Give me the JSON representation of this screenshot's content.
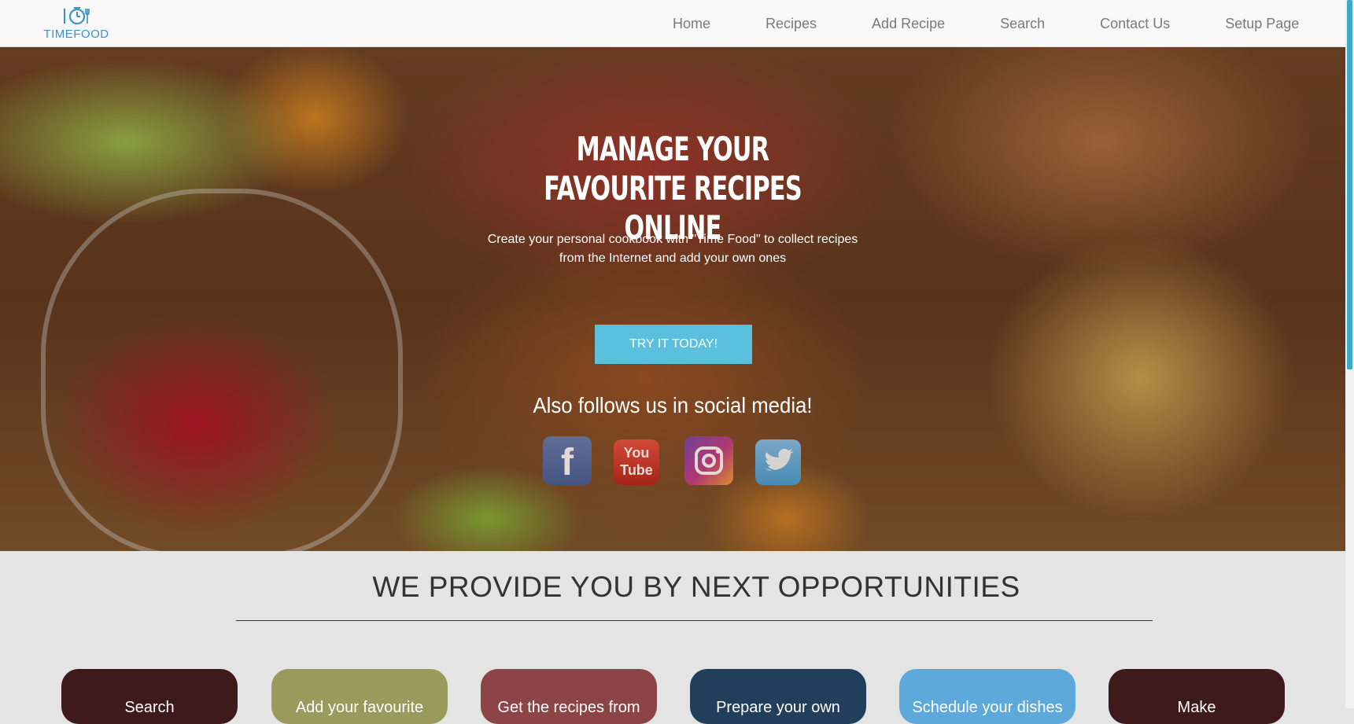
{
  "brand": {
    "name": "TIMEFOOD",
    "accent": "#3d92c5"
  },
  "nav": {
    "items": [
      {
        "label": "Home"
      },
      {
        "label": "Recipes"
      },
      {
        "label": "Add Recipe"
      },
      {
        "label": "Search"
      },
      {
        "label": "Contact Us"
      },
      {
        "label": "Setup Page"
      }
    ]
  },
  "hero": {
    "title": "MANAGE YOUR FAVOURITE RECIPES ONLINE",
    "subtitle_line1": "Create your personal cookbook with \"Time Food\" to collect recipes",
    "subtitle_line2": "from the Internet and add your own ones",
    "cta_label": "TRY IT TODAY!",
    "cta_color": "#5bc0de",
    "social_title": "Also follows us in social media!",
    "social": [
      {
        "icon": "facebook-icon",
        "glyph": "f"
      },
      {
        "icon": "youtube-icon",
        "glyph": "You Tube"
      },
      {
        "icon": "instagram-icon"
      },
      {
        "icon": "twitter-icon"
      }
    ]
  },
  "section": {
    "title": "WE PROVIDE YOU BY NEXT OPPORTUNITIES"
  },
  "cards": [
    {
      "label": "Search",
      "color": "#3f1a1d"
    },
    {
      "label": "Add your favourite",
      "color": "#9a9a5c"
    },
    {
      "label": "Get the recipes from",
      "color": "#8c4446"
    },
    {
      "label": "Prepare your own",
      "color": "#213f5a"
    },
    {
      "label": "Schedule your dishes",
      "color": "#5ea9dc"
    },
    {
      "label": "Make",
      "color": "#3f1a1d"
    }
  ],
  "scrollbar_color": "#3fa7c9"
}
